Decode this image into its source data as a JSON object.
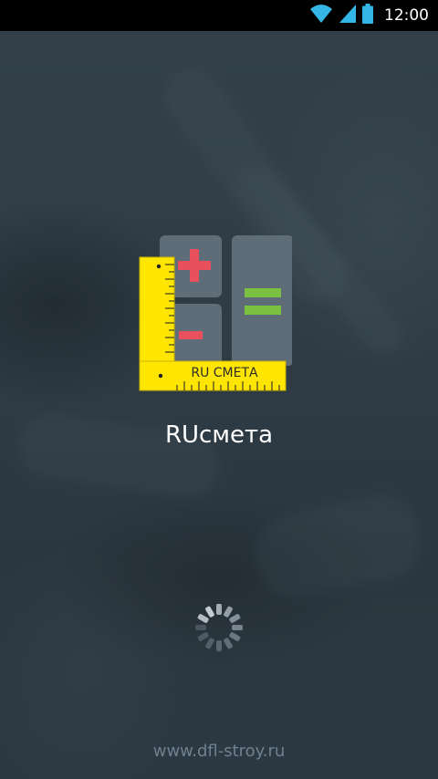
{
  "status_bar": {
    "time": "12:00",
    "icons": [
      "wifi-icon",
      "cell-signal-icon",
      "battery-icon"
    ]
  },
  "splash": {
    "logo_label": "RU СМЕТА",
    "app_name": "RUсмета",
    "footer_url": "www.dfl-stroy.ru",
    "loading": true
  },
  "colors": {
    "status_bar": "#000000",
    "background": "#2f3b45",
    "tile": "#5f6d78",
    "plus_minus": "#e8505b",
    "equals": "#7cc242",
    "ruler": "#ffe600",
    "footer_text": "#6f8191"
  }
}
